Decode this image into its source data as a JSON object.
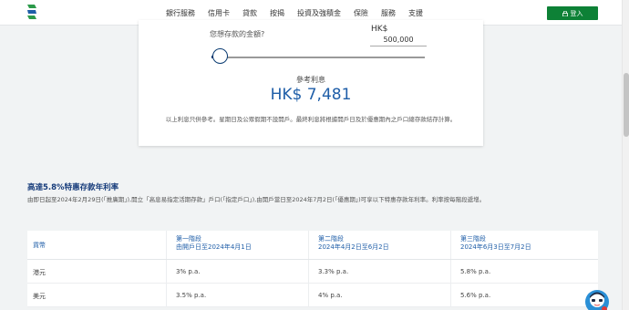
{
  "nav": {
    "items": [
      "銀行服務",
      "信用卡",
      "貸款",
      "按揭",
      "投資及強積金",
      "保險",
      "服務",
      "支援"
    ],
    "login_label": "登入"
  },
  "calculator": {
    "question": "您想存款的金額?",
    "currency": "HK$",
    "amount": "500,000",
    "slider_value": 500000,
    "ref_label": "參考利息",
    "ref_value": "HK$ 7,481",
    "disclaimer": "以上利息只供參考。星期日及公眾假期不設開戶。最終利息將根據開戶日及於優惠期內之戶口總存款結存計算。"
  },
  "promo": {
    "title": "高達5.8%特惠存款年利率",
    "description": "由即日起至2024年2月29日(「推廣期」),開立「高息易指定活期存款」戶口(「指定戶口」),由開戶當日至2024年7月2日(「優惠期」)可享以下特惠存款年利率。利率按每階段遞增。"
  },
  "rate_table": {
    "headers": [
      {
        "line1": "貨幣",
        "line2": ""
      },
      {
        "line1": "第一階段",
        "line2": "由開戶日至2024年4月1日"
      },
      {
        "line1": "第二階段",
        "line2": "2024年4月2日至6月2日"
      },
      {
        "line1": "第三階段",
        "line2": "2024年6月3日至7月2日"
      }
    ],
    "rows": [
      {
        "currency": "港元",
        "stage1": "3% p.a.",
        "stage2": "3.3% p.a.",
        "stage3": "5.8% p.a."
      },
      {
        "currency": "美元",
        "stage1": "3.5% p.a.",
        "stage2": "4% p.a.",
        "stage3": "5.6% p.a."
      }
    ]
  },
  "colors": {
    "brand_green": "#0d8136",
    "accent_blue": "#1f5ea8",
    "title_navy": "#163b7a"
  }
}
